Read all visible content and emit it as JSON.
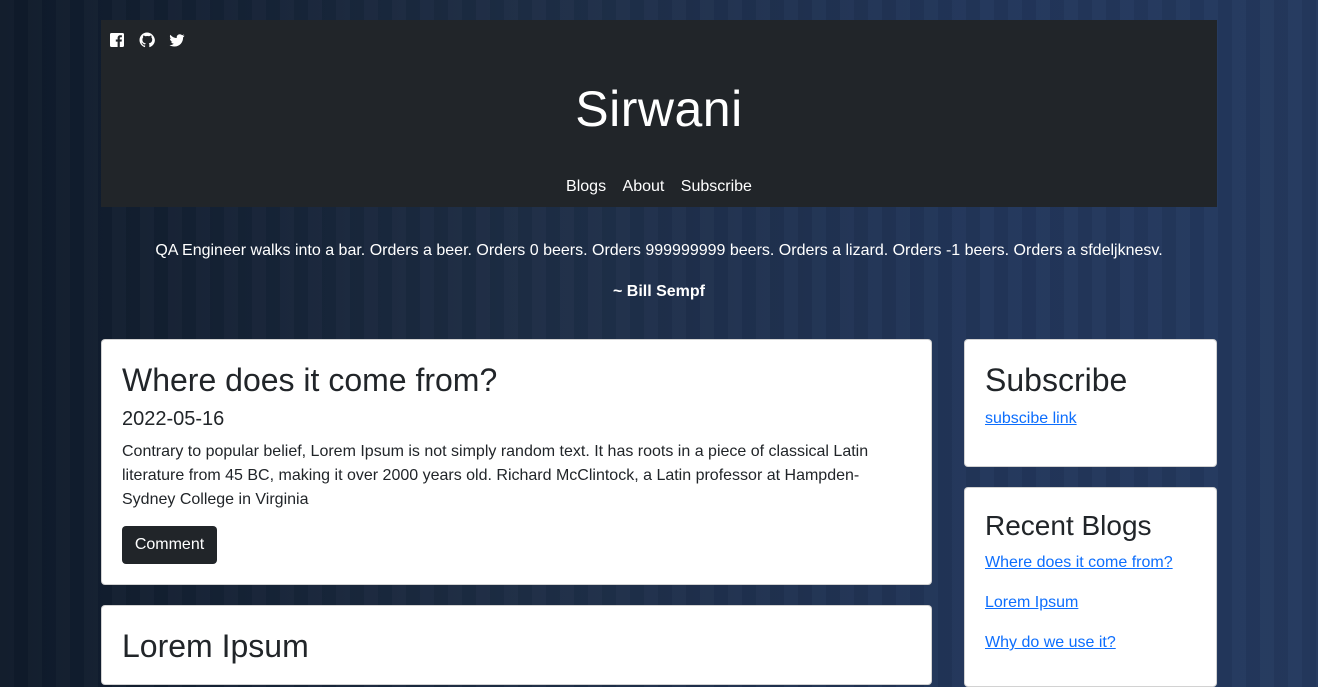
{
  "header": {
    "site_title": "Sirwani",
    "social_icons": [
      "facebook-icon",
      "github-icon",
      "twitter-icon"
    ],
    "nav": [
      "Blogs",
      "About",
      "Subscribe"
    ]
  },
  "quote": {
    "text": "QA Engineer walks into a bar. Orders a beer. Orders 0 beers. Orders 999999999 beers. Orders a lizard. Orders -1 beers. Orders a sfdeljknesv.",
    "author": "~ Bill Sempf"
  },
  "posts": [
    {
      "title": "Where does it come from?",
      "date": "2022-05-16",
      "body": "Contrary to popular belief, Lorem Ipsum is not simply random text. It has roots in a piece of classical Latin literature from 45 BC, making it over 2000 years old. Richard McClintock, a Latin professor at Hampden-Sydney College in Virginia",
      "button": "Comment"
    },
    {
      "title": "Lorem Ipsum"
    }
  ],
  "sidebar": {
    "subscribe": {
      "title": "Subscribe",
      "link": "subscibe link"
    },
    "recent": {
      "title": "Recent Blogs",
      "links": [
        "Where does it come from?",
        "Lorem Ipsum",
        "Why do we use it?"
      ]
    }
  },
  "colors": {
    "header_bg": "#212529",
    "link": "#0d6efd",
    "button_bg": "#212529"
  }
}
